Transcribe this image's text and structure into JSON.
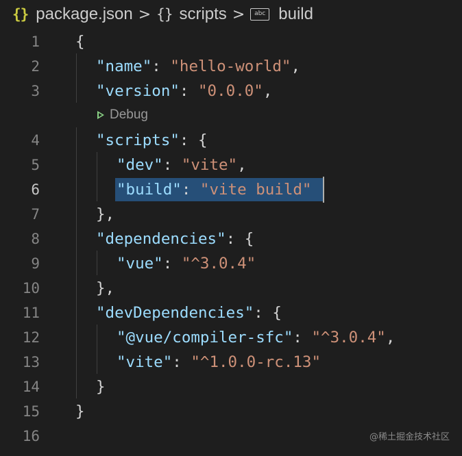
{
  "breadcrumb": {
    "file_icon": "{}",
    "file_name": "package.json",
    "separator": ">",
    "object_icon": "{}",
    "scripts": "scripts",
    "string_icon": "abc",
    "build": "build"
  },
  "editor": {
    "lines": [
      {
        "number": "1",
        "tokens": [
          [
            "p",
            "{"
          ]
        ]
      },
      {
        "number": "2",
        "tokens": [
          [
            "k",
            "\"name\""
          ],
          [
            "p",
            ": "
          ],
          [
            "s",
            "\"hello-world\""
          ],
          [
            "p",
            ","
          ]
        ]
      },
      {
        "number": "3",
        "tokens": [
          [
            "k",
            "\"version\""
          ],
          [
            "p",
            ": "
          ],
          [
            "s",
            "\"0.0.0\""
          ],
          [
            "p",
            ","
          ]
        ]
      },
      {
        "number": "4",
        "tokens": [
          [
            "k",
            "\"scripts\""
          ],
          [
            "p",
            ": {"
          ]
        ]
      },
      {
        "number": "5",
        "tokens": [
          [
            "k",
            "\"dev\""
          ],
          [
            "p",
            ": "
          ],
          [
            "s",
            "\"vite\""
          ],
          [
            "p",
            ","
          ]
        ]
      },
      {
        "number": "6",
        "tokens": [
          [
            "k",
            "\"build\""
          ],
          [
            "p",
            ": "
          ],
          [
            "s",
            "\"vite build\""
          ]
        ]
      },
      {
        "number": "7",
        "tokens": [
          [
            "p",
            "},"
          ]
        ]
      },
      {
        "number": "8",
        "tokens": [
          [
            "k",
            "\"dependencies\""
          ],
          [
            "p",
            ": {"
          ]
        ]
      },
      {
        "number": "9",
        "tokens": [
          [
            "k",
            "\"vue\""
          ],
          [
            "p",
            ": "
          ],
          [
            "s",
            "\"^3.0.4\""
          ]
        ]
      },
      {
        "number": "10",
        "tokens": [
          [
            "p",
            "},"
          ]
        ]
      },
      {
        "number": "11",
        "tokens": [
          [
            "k",
            "\"devDependencies\""
          ],
          [
            "p",
            ": {"
          ]
        ]
      },
      {
        "number": "12",
        "tokens": [
          [
            "k",
            "\"@vue/compiler-sfc\""
          ],
          [
            "p",
            ": "
          ],
          [
            "s",
            "\"^3.0.4\""
          ],
          [
            "p",
            ","
          ]
        ]
      },
      {
        "number": "13",
        "tokens": [
          [
            "k",
            "\"vite\""
          ],
          [
            "p",
            ": "
          ],
          [
            "s",
            "\"^1.0.0-rc.13\""
          ]
        ]
      },
      {
        "number": "14",
        "tokens": [
          [
            "p",
            "}"
          ]
        ]
      },
      {
        "number": "15",
        "tokens": [
          [
            "p",
            "}"
          ]
        ]
      },
      {
        "number": "16",
        "tokens": []
      }
    ],
    "active_line": "6",
    "codelens_label": "Debug"
  },
  "watermark": "@稀土掘金技术社区",
  "colors": {
    "background": "#1e1e1e",
    "key": "#9cdcfe",
    "string": "#ce9178",
    "punctuation": "#d4d4d4",
    "selection": "#264f78",
    "json_icon": "#cbcb41",
    "play_icon": "#89d185"
  }
}
